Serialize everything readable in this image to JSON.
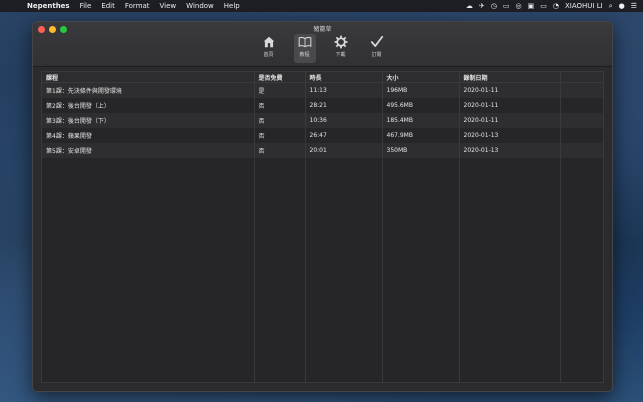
{
  "menubar": {
    "app_name": "Nepenthes",
    "items": [
      "File",
      "Edit",
      "Format",
      "View",
      "Window",
      "Help"
    ],
    "user": "XIAOHUI LI"
  },
  "window": {
    "title": "豬籠草",
    "toolbar": [
      {
        "label": "首頁",
        "icon": "home-icon"
      },
      {
        "label": "教程",
        "icon": "book-icon",
        "active": true
      },
      {
        "label": "下載",
        "icon": "gear-icon"
      },
      {
        "label": "訂閱",
        "icon": "checkmark-icon"
      }
    ]
  },
  "table": {
    "headers": [
      "課程",
      "是否免費",
      "時長",
      "大小",
      "錄制日期"
    ],
    "rows": [
      [
        "第1課：先決條件與開發環境",
        "是",
        "11:13",
        "196MB",
        "2020-01-11"
      ],
      [
        "第2課：後台開發（上）",
        "否",
        "28:21",
        "495.6MB",
        "2020-01-11"
      ],
      [
        "第3課：後台開發（下）",
        "否",
        "10:36",
        "185.4MB",
        "2020-01-11"
      ],
      [
        "第4課：蘋果開發",
        "否",
        "26:47",
        "467.9MB",
        "2020-01-13"
      ],
      [
        "第5課：安卓開發",
        "否",
        "20:01",
        "350MB",
        "2020-01-13"
      ]
    ]
  }
}
